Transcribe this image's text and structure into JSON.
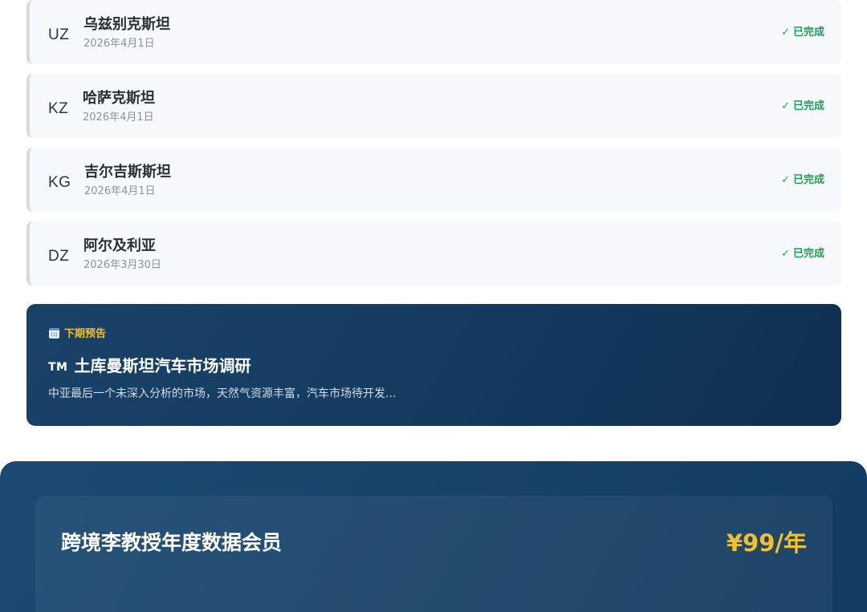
{
  "reports": [
    {
      "code": "UZ",
      "name": "乌兹别克斯坦",
      "date": "2026年4月1日",
      "status_icon": "✓",
      "status": "已完成"
    },
    {
      "code": "KZ",
      "name": "哈萨克斯坦",
      "date": "2026年4月1日",
      "status_icon": "✓",
      "status": "已完成"
    },
    {
      "code": "KG",
      "name": "吉尔吉斯斯坦",
      "date": "2026年4月1日",
      "status_icon": "✓",
      "status": "已完成"
    },
    {
      "code": "DZ",
      "name": "阿尔及利亚",
      "date": "2026年3月30日",
      "status_icon": "✓",
      "status": "已完成"
    }
  ],
  "next_issue": {
    "icon": "calendar-icon",
    "tag": "下期预告",
    "badge": "TM",
    "title": "土库曼斯坦汽车市场调研",
    "description": "中亚最后一个未深入分析的市场，天然气资源丰富，汽车市场待开发..."
  },
  "membership": {
    "plan_name": "跨境李教授年度数据会员",
    "price": "¥99/年"
  },
  "colors": {
    "status_done": "#1f9d55",
    "accent_gold": "#f2c02e",
    "card_navy": "#143a5f"
  }
}
